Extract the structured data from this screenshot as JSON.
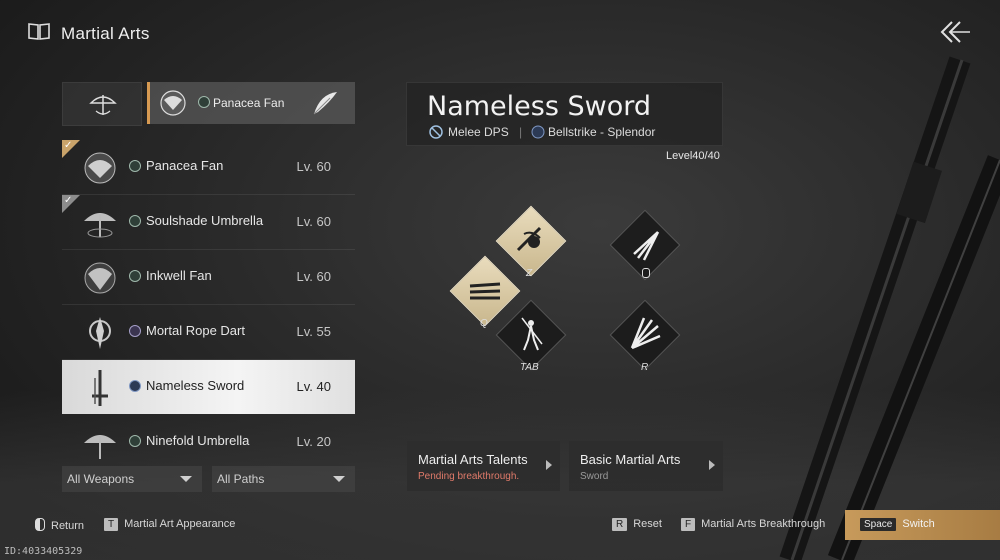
{
  "header": {
    "title": "Martial Arts",
    "back_icon": "back-arrow-icon"
  },
  "path_selector": {
    "active_label": "Panacea Fan"
  },
  "weapons": [
    {
      "name": "Panacea Fan",
      "level": "Lv. 60",
      "icon": "fan-icon",
      "equipped": true
    },
    {
      "name": "Soulshade Umbrella",
      "level": "Lv. 60",
      "icon": "umbrella-icon",
      "equipped": true
    },
    {
      "name": "Inkwell Fan",
      "level": "Lv. 60",
      "icon": "fan-icon",
      "equipped": false
    },
    {
      "name": "Mortal Rope Dart",
      "level": "Lv. 55",
      "icon": "rope-dart-icon",
      "equipped": false
    },
    {
      "name": "Nameless Sword",
      "level": "Lv. 40",
      "icon": "sword-icon",
      "equipped": false,
      "selected": true
    },
    {
      "name": "Ninefold Umbrella",
      "level": "Lv. 20",
      "icon": "umbrella-icon",
      "equipped": false
    }
  ],
  "filters": {
    "weapons": "All Weapons",
    "paths": "All Paths"
  },
  "detail": {
    "title": "Nameless Sword",
    "role": "Melee DPS",
    "path": "Bellstrike - Splendor",
    "level": "Level40/40"
  },
  "skills": {
    "z": "Z",
    "q": "Q",
    "tab": "TAB",
    "r": "R"
  },
  "tabs": {
    "talents": {
      "title": "Martial Arts Talents",
      "sub": "Pending breakthrough."
    },
    "basic": {
      "title": "Basic Martial Arts",
      "sub": "Sword"
    }
  },
  "footer": {
    "return_label": "Return",
    "appearance_key": "T",
    "appearance_label": "Martial Art Appearance",
    "reset_key": "R",
    "reset_label": "Reset",
    "breakthrough_key": "F",
    "breakthrough_label": "Martial Arts Breakthrough",
    "switch_key": "Space",
    "switch_label": "Switch"
  },
  "build_id": "ID:4033405329",
  "colors": {
    "accent": "#c79a5b",
    "warning": "#e07a6a",
    "selected_row": "#eeeeee"
  }
}
